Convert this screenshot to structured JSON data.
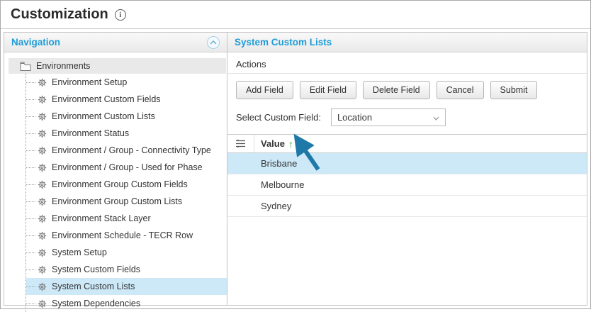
{
  "titlebar": {
    "title": "Customization",
    "info_icon": "i"
  },
  "navigation": {
    "header": "Navigation",
    "root_label": "Environments",
    "items": [
      {
        "label": "Environment Setup",
        "selected": false
      },
      {
        "label": "Environment Custom Fields",
        "selected": false
      },
      {
        "label": "Environment Custom Lists",
        "selected": false
      },
      {
        "label": "Environment Status",
        "selected": false
      },
      {
        "label": "Environment / Group - Connectivity Type",
        "selected": false
      },
      {
        "label": "Environment / Group - Used for Phase",
        "selected": false
      },
      {
        "label": "Environment Group Custom Fields",
        "selected": false
      },
      {
        "label": "Environment Group Custom Lists",
        "selected": false
      },
      {
        "label": "Environment Stack Layer",
        "selected": false
      },
      {
        "label": "Environment Schedule - TECR Row",
        "selected": false
      },
      {
        "label": "System Setup",
        "selected": false
      },
      {
        "label": "System Custom Fields",
        "selected": false
      },
      {
        "label": "System Custom Lists",
        "selected": true
      },
      {
        "label": "System Dependencies",
        "selected": false
      }
    ]
  },
  "main": {
    "header": "System Custom Lists",
    "actions_label": "Actions",
    "buttons": [
      {
        "label": "Add Field"
      },
      {
        "label": "Edit Field"
      },
      {
        "label": "Delete Field"
      },
      {
        "label": "Cancel"
      },
      {
        "label": "Submit"
      }
    ],
    "select_field": {
      "label": "Select Custom Field:",
      "value": "Location"
    },
    "table": {
      "value_header": "Value",
      "sort_direction": "ascending",
      "sort_indicator": "↑",
      "rows": [
        {
          "value": "Brisbane",
          "selected": true
        },
        {
          "value": "Melbourne",
          "selected": false
        },
        {
          "value": "Sydney",
          "selected": false
        }
      ]
    }
  },
  "colors": {
    "accent_blue": "#1E9CD8",
    "selection_blue": "#CDE9F8",
    "sort_arrow_green": "#2CA02C",
    "annotation_arrow": "#1F79A8"
  }
}
